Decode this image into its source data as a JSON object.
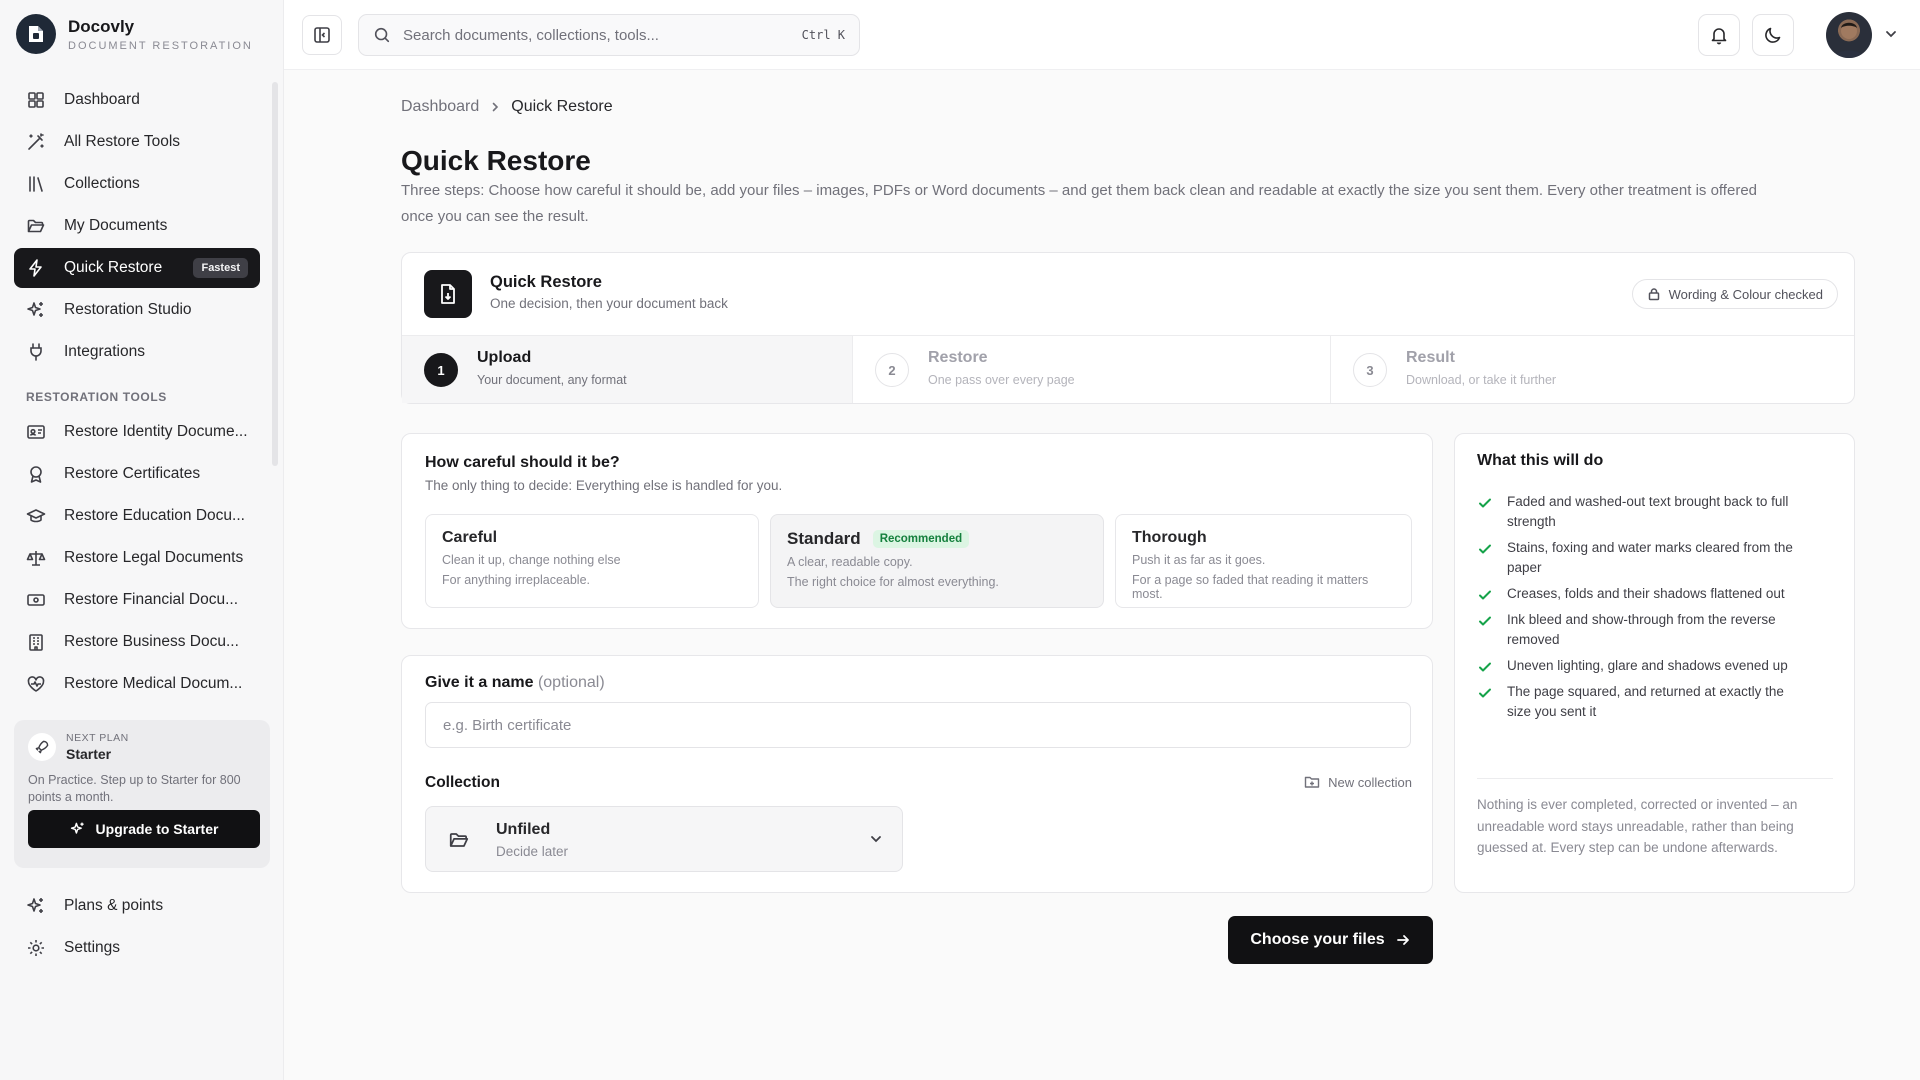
{
  "brand": {
    "name": "Docovly",
    "subtitle": "DOCUMENT RESTORATION"
  },
  "sidebar": {
    "main_items": [
      {
        "label": "Dashboard",
        "icon": "grid-icon"
      },
      {
        "label": "All Restore Tools",
        "icon": "wand-icon"
      },
      {
        "label": "Collections",
        "icon": "library-icon"
      },
      {
        "label": "My Documents",
        "icon": "folder-open-icon"
      },
      {
        "label": "Quick Restore",
        "icon": "lightning-icon",
        "badge": "Fastest",
        "active": true
      },
      {
        "label": "Restoration Studio",
        "icon": "sparkles-icon"
      },
      {
        "label": "Integrations",
        "icon": "plug-icon"
      }
    ],
    "section_label": "RESTORATION TOOLS",
    "tool_items": [
      {
        "label": "Restore Identity Docume...",
        "icon": "id-card-icon"
      },
      {
        "label": "Restore Certificates",
        "icon": "award-icon"
      },
      {
        "label": "Restore Education Docu...",
        "icon": "graduation-cap-icon"
      },
      {
        "label": "Restore Legal Documents",
        "icon": "scale-icon"
      },
      {
        "label": "Restore Financial Docu...",
        "icon": "banknote-icon"
      },
      {
        "label": "Restore Business Docu...",
        "icon": "building-icon"
      },
      {
        "label": "Restore Medical Docum...",
        "icon": "heart-pulse-icon"
      }
    ],
    "plan": {
      "kicker": "NEXT PLAN",
      "name": "Starter",
      "description": "On Practice. Step up to Starter for 800 points a month.",
      "upgrade_label": "Upgrade to Starter"
    },
    "bottom_items": [
      {
        "label": "Plans & points",
        "icon": "sparkles-icon"
      },
      {
        "label": "Settings",
        "icon": "gear-icon"
      }
    ]
  },
  "topbar": {
    "search_placeholder": "Search documents, collections, tools...",
    "search_shortcut": "Ctrl K"
  },
  "breadcrumb": {
    "parent": "Dashboard",
    "current": "Quick Restore"
  },
  "page": {
    "title": "Quick Restore",
    "description": "Three steps: Choose how careful it should be, add your files – images, PDFs or Word documents – and get them back clean and readable at exactly the size you sent them. Every other treatment is offered once you can see the result."
  },
  "stepper": {
    "title": "Quick Restore",
    "subtitle": "One decision, then your document back",
    "checked_chip": "Wording & Colour checked",
    "steps": [
      {
        "num": "1",
        "title": "Upload",
        "sub": "Your document, any format",
        "active": true
      },
      {
        "num": "2",
        "title": "Restore",
        "sub": "One pass over every page",
        "active": false
      },
      {
        "num": "3",
        "title": "Result",
        "sub": "Download, or take it further",
        "active": false
      }
    ]
  },
  "care": {
    "title": "How careful should it be?",
    "subtitle": "The only thing to decide: Everything else is handled for you.",
    "options": [
      {
        "title": "Careful",
        "line1": "Clean it up, change nothing else",
        "line2": "For anything irreplaceable.",
        "selected": false
      },
      {
        "title": "Standard",
        "badge": "Recommended",
        "line1": "A clear, readable copy.",
        "line2": "The right choice for almost everything.",
        "selected": true
      },
      {
        "title": "Thorough",
        "line1": "Push it as far as it goes.",
        "line2": "For a page so faded that reading it matters most.",
        "selected": false
      }
    ]
  },
  "naming": {
    "label": "Give it a name",
    "optional": "(optional)",
    "placeholder": "e.g. Birth certificate",
    "value": "",
    "collection_label": "Collection",
    "new_collection": "New collection",
    "collection_value": "Unfiled",
    "collection_sub": "Decide later"
  },
  "what": {
    "title": "What this will do",
    "items": [
      "Faded and washed-out text brought back to full strength",
      "Stains, foxing and water marks cleared from the paper",
      "Creases, folds and their shadows flattened out",
      "Ink bleed and show-through from the reverse removed",
      "Uneven lighting, glare and shadows evened up",
      "The page squared, and returned at exactly the size you sent it"
    ],
    "note": "Nothing is ever completed, corrected or invented – an unreadable word stays unreadable, rather than being guessed at. Every step can be undone afterwards."
  },
  "actions": {
    "choose_files": "Choose your files"
  },
  "colors": {
    "accent": "#18181b",
    "success": "#16a34a",
    "recommended_bg": "#dcf5e3"
  }
}
